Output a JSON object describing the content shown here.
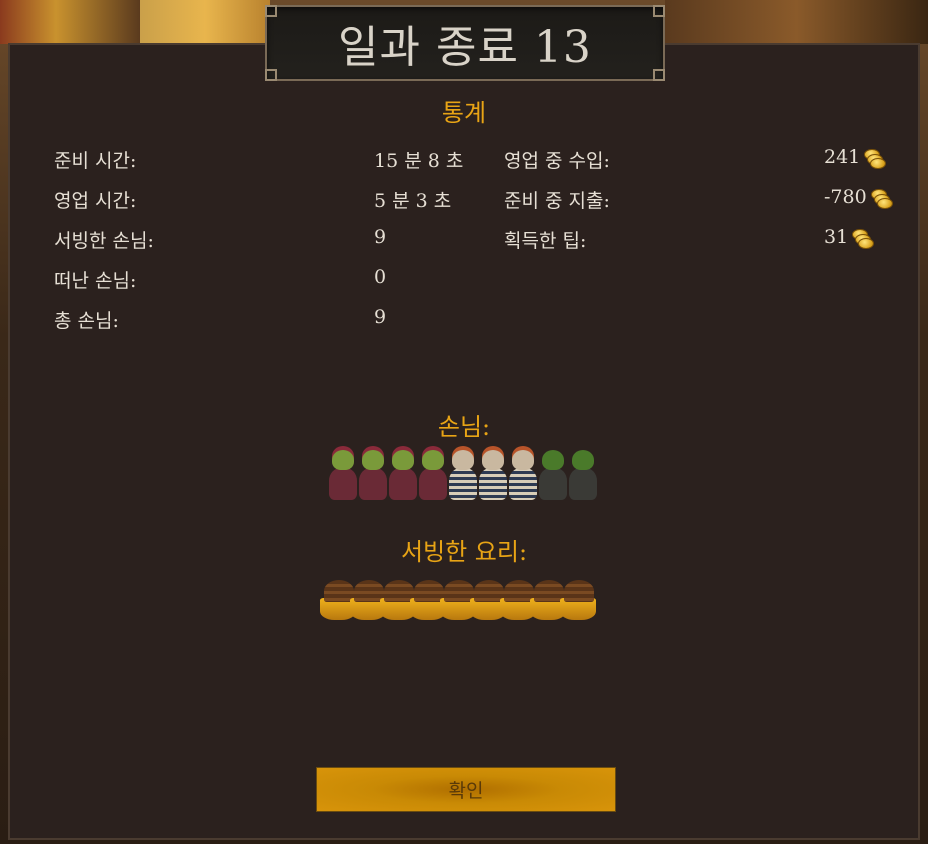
{
  "title": "일과 종료 13",
  "stats_heading": "통계",
  "left_stats": [
    {
      "label": "준비 시간:",
      "value": "15 분 8 초"
    },
    {
      "label": "영업 시간:",
      "value": "5 분 3 초"
    },
    {
      "label": "서빙한 손님:",
      "value": "9"
    },
    {
      "label": "떠난 손님:",
      "value": "0"
    },
    {
      "label": "총 손님:",
      "value": "9"
    }
  ],
  "right_stats": [
    {
      "label": "영업 중 수입:",
      "value": "241",
      "icon": "coin-icon"
    },
    {
      "label": "준비 중 지출:",
      "value": "-780",
      "icon": "coin-icon"
    },
    {
      "label": "획득한 팁:",
      "value": "31",
      "icon": "coin-icon"
    }
  ],
  "customers_heading": "손님:",
  "customers": [
    {
      "type": "goblin-red"
    },
    {
      "type": "goblin-red"
    },
    {
      "type": "goblin-red"
    },
    {
      "type": "goblin-red"
    },
    {
      "type": "skeleton"
    },
    {
      "type": "skeleton"
    },
    {
      "type": "skeleton"
    },
    {
      "type": "goblin-green"
    },
    {
      "type": "goblin-green"
    }
  ],
  "dishes_heading": "서빙한 요리:",
  "dishes_count": 9,
  "confirm_label": "확인",
  "colors": {
    "accent": "#e8a415",
    "panel": "#2b211e",
    "text": "#e6dfd4",
    "button": "#c98a05"
  }
}
